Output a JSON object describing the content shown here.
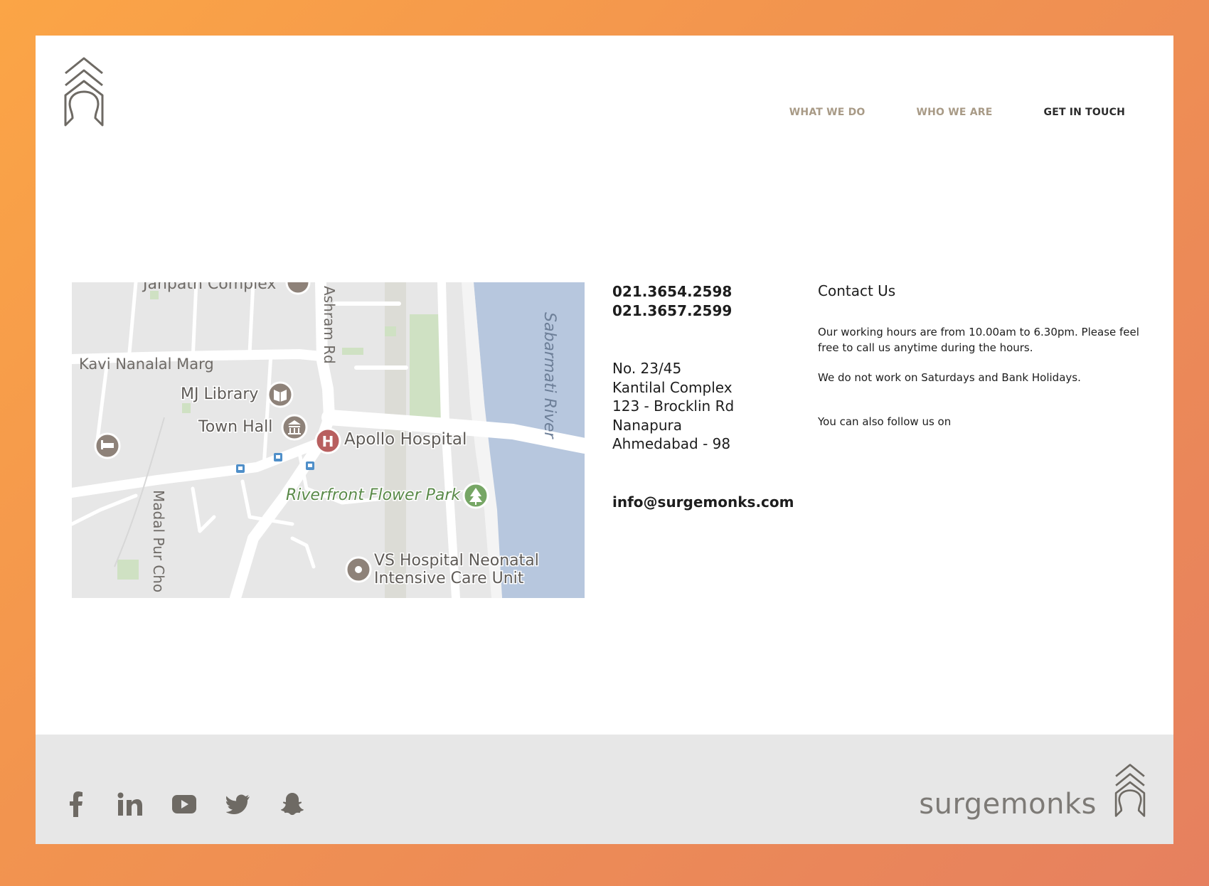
{
  "nav": {
    "items": [
      {
        "label": "WHAT WE DO",
        "active": false
      },
      {
        "label": "WHO WE ARE",
        "active": false
      },
      {
        "label": "GET IN TOUCH",
        "active": true
      }
    ]
  },
  "map": {
    "labels": {
      "janpath": "Janpath Complex",
      "ashram": "Ashram Rd",
      "kavi": "Kavi Nanalal Marg",
      "library": "MJ Library",
      "townhall": "Town Hall",
      "apollo": "Apollo Hospital",
      "river": "Sabarmati River",
      "flower": "Riverfront Flower Park",
      "madal": "Madal Pur Cho",
      "vs1": "VS Hospital Neonatal",
      "vs2": "Intensive Care Unit"
    },
    "colors": {
      "land": "#e7e7e7",
      "road": "#ffffff",
      "water": "#b7c7de",
      "park": "#cfe1c3",
      "poi": "#8e8279",
      "hospital": "#b85f5f",
      "park_poi": "#76a665",
      "transit": "#4f8fc9"
    }
  },
  "contact": {
    "phones": [
      "021.3654.2598",
      "021.3657.2599"
    ],
    "address": [
      "No. 23/45",
      "Kantilal Complex",
      "123 - Brocklin Rd",
      "Nanapura",
      "Ahmedabad - 98"
    ],
    "email": "info@surgemonks.com",
    "title": "Contact Us",
    "hours": "Our working hours are from 10.00am to 6.30pm. Please feel free to call us anytime during the hours.",
    "closed": "We do not work on Saturdays and Bank Holidays.",
    "follow": "You can also follow us on"
  },
  "footer": {
    "socials": [
      "facebook-icon",
      "linkedin-icon",
      "youtube-icon",
      "twitter-icon",
      "snapchat-icon"
    ],
    "brand": "surgemonks"
  },
  "colors": {
    "accent": "#a89a86",
    "text": "#1d1d1d",
    "footer_bg": "#e7e7e7",
    "icon": "#6e6a64"
  }
}
